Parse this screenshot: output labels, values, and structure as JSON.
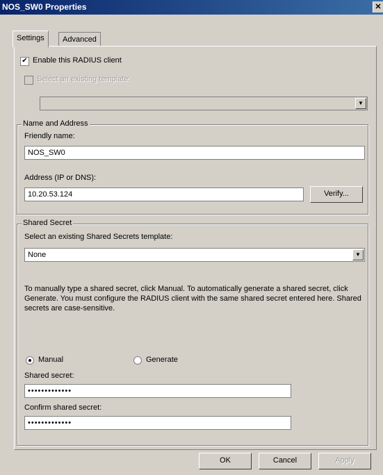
{
  "window": {
    "title": "NOS_SW0 Properties",
    "close_glyph": "✕"
  },
  "tabs": [
    {
      "label": "Settings",
      "active": true
    },
    {
      "label": "Advanced",
      "active": false
    }
  ],
  "enable_checkbox": {
    "label": "Enable this RADIUS client",
    "checked": true
  },
  "template_checkbox": {
    "label": "Select an existing template:",
    "checked": false,
    "enabled": false
  },
  "template_combo": {
    "value": "",
    "enabled": false
  },
  "name_address": {
    "legend": "Name and Address",
    "friendly_label": "Friendly name:",
    "friendly_value": "NOS_SW0",
    "address_label": "Address (IP or DNS):",
    "address_value": "10.20.53.124",
    "verify_label": "Verify..."
  },
  "shared_secret": {
    "legend": "Shared Secret",
    "template_label": "Select an existing Shared Secrets template:",
    "template_value": "None",
    "description": "To manually type a shared secret, click Manual. To automatically generate a shared secret, click Generate. You must configure the RADIUS client with the same shared secret entered here. Shared secrets are case-sensitive.",
    "manual_label": "Manual",
    "generate_label": "Generate",
    "selected_mode": "Manual",
    "secret_label": "Shared secret:",
    "secret_value": "•••••••••••••",
    "confirm_label": "Confirm shared secret:",
    "confirm_value": "•••••••••••••"
  },
  "buttons": {
    "ok": "OK",
    "cancel": "Cancel",
    "apply": "Apply"
  }
}
